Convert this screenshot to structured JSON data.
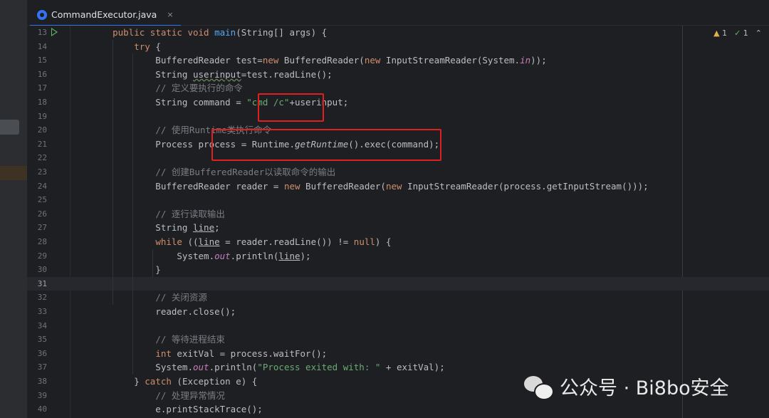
{
  "tab": {
    "filename": "CommandExecutor.java",
    "close": "×"
  },
  "inspections": {
    "warnings": "1",
    "checks": "1"
  },
  "lines": [
    {
      "num": "13",
      "html": "    <span class=\"kw\">public static void</span> <span class=\"fn\">main</span>(String[] args) {",
      "run": true
    },
    {
      "num": "14",
      "html": "        <span class=\"kw\">try</span> {"
    },
    {
      "num": "15",
      "html": "            BufferedReader test=<span class=\"kw\">new</span> BufferedReader(<span class=\"kw\">new</span> InputStreamReader(System.<span class=\"it\">in</span>));"
    },
    {
      "num": "16",
      "html": "            String <span class=\"wv\">userinput</span>=test.readLine();"
    },
    {
      "num": "17",
      "html": "            <span class=\"cm\">// 定义要执行的命令</span>"
    },
    {
      "num": "18",
      "html": "            String command = <span class=\"st\">\"cmd /c\"</span>+userinput;"
    },
    {
      "num": "19",
      "html": ""
    },
    {
      "num": "20",
      "html": "            <span class=\"cm\">// 使用Runtime类执行命令</span>"
    },
    {
      "num": "21",
      "html": "            Process process = Runtime.<span class=\"mi\">getRuntime</span>().exec(command);"
    },
    {
      "num": "22",
      "html": ""
    },
    {
      "num": "23",
      "html": "            <span class=\"cm\">// 创建BufferedReader以读取命令的输出</span>"
    },
    {
      "num": "24",
      "html": "            BufferedReader reader = <span class=\"kw\">new</span> BufferedReader(<span class=\"kw\">new</span> InputStreamReader(process.getInputStream()));"
    },
    {
      "num": "25",
      "html": ""
    },
    {
      "num": "26",
      "html": "            <span class=\"cm\">// 逐行读取输出</span>"
    },
    {
      "num": "27",
      "html": "            String <span class=\"ul\">line</span>;"
    },
    {
      "num": "28",
      "html": "            <span class=\"kw\">while</span> ((<span class=\"ul\">line</span> = reader.readLine()) != <span class=\"kw\">null</span>) {"
    },
    {
      "num": "29",
      "html": "                System.<span class=\"it\">out</span>.println(<span class=\"ul\">line</span>);"
    },
    {
      "num": "30",
      "html": "            }"
    },
    {
      "num": "31",
      "html": "",
      "current": true
    },
    {
      "num": "32",
      "html": "            <span class=\"cm\">// 关闭资源</span>"
    },
    {
      "num": "33",
      "html": "            reader.close();"
    },
    {
      "num": "34",
      "html": ""
    },
    {
      "num": "35",
      "html": "            <span class=\"cm\">// 等待进程结束</span>"
    },
    {
      "num": "36",
      "html": "            <span class=\"kw\">int</span> exitVal = process.waitFor();"
    },
    {
      "num": "37",
      "html": "            System.<span class=\"it\">out</span>.println(<span class=\"st\">\"Process exited with: \"</span> + exitVal);"
    },
    {
      "num": "38",
      "html": "        } <span class=\"kw\">catch</span> (Exception e) {"
    },
    {
      "num": "39",
      "html": "            <span class=\"cm\">// 处理异常情况</span>"
    },
    {
      "num": "40",
      "html": "            e.printStackTrace();"
    }
  ],
  "watermark": {
    "text": "公众号 · Bi8bo安全"
  },
  "colors": {
    "highlight_box": "#e0201f",
    "keyword": "#cf8e6d",
    "string": "#6aab73",
    "method": "#56a8f5",
    "comment": "#7a7e85"
  }
}
